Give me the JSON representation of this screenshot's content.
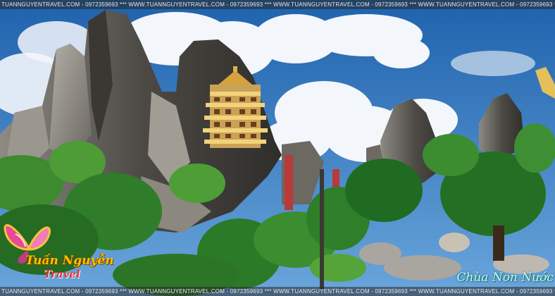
{
  "watermark": {
    "top_text": "TUANNGUYENTRAVEL.COM - 0972359693 *** WWW.TUANNGUYENTRAVEL.COM - 0972359693 *** WWW.TUANNGUYENTRAVEL.COM - 0972359693 *** WWW.TUANNGUYENTRAVEL.COM - 0972359693 *** WWW.TUANNGUYENTRAVEL.COM - 0972359693",
    "bottom_text": "TUANNGUYENTRAVEL.COM - 0972359693 *** WWW.TUANNGUYENTRAVEL.COM - 0972359693 *** WWW.TUANNGUYENTRAVEL.COM - 0972359693 *** WWW.TUANNGUYENTRAVEL.COM - 0972359693 *** WWW.TUANNGUYENTRAVEL.COM - 0972359693"
  },
  "logo": {
    "name": "Tuấn Nguyễn",
    "sub": "Travel"
  },
  "place_tag": "Chùa Non Nước",
  "colors": {
    "sky": "#2b6fb3",
    "cloud": "#f3f6fa",
    "rock": "#5a5650",
    "foliage": "#2f7d2a",
    "pagoda_gold": "#e0b04a",
    "logo_pink": "#e84a9a"
  }
}
